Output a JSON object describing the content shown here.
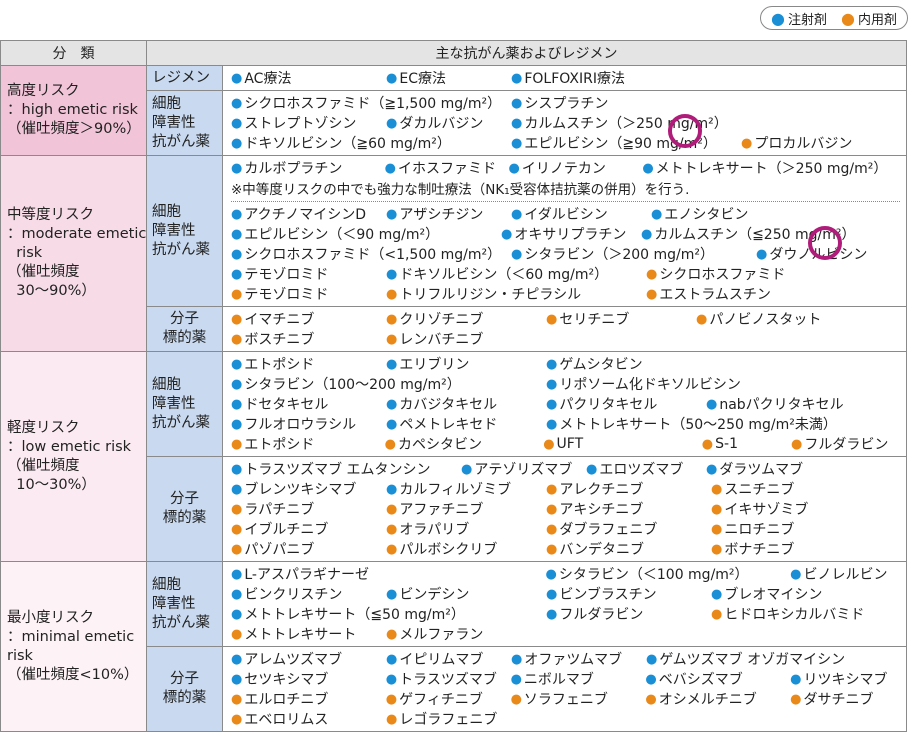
{
  "legend": {
    "injection": "注射剤",
    "oral": "内用剤"
  },
  "colors": {
    "injection": "#1a8fd6",
    "oral": "#e8891a",
    "circle": "#b01c7a"
  },
  "header": {
    "category": "分　類",
    "drugs": "主な抗がん薬およびレジメン"
  },
  "high": {
    "label": [
      "高度リスク",
      "：high emetic risk",
      "（催吐頻度＞90%）"
    ],
    "regimen_label": "レジメン",
    "regimens": [
      [
        {
          "t": "AC療法",
          "k": "b",
          "w": 155
        },
        {
          "t": "EC療法",
          "k": "b",
          "w": 125
        },
        {
          "t": "FOLFOXIRI療法",
          "k": "b",
          "w": 200
        }
      ]
    ],
    "cyto_label": [
      "細胞",
      "障害性",
      "抗がん薬"
    ],
    "cyto": [
      [
        {
          "t": "シクロホスファミド（≧1,500 mg/m²）",
          "k": "b",
          "w": 280
        },
        {
          "t": "シスプラチン",
          "k": "b",
          "w": 200
        }
      ],
      [
        {
          "t": "ストレプトゾシン",
          "k": "b",
          "w": 155
        },
        {
          "t": "ダカルバジン",
          "k": "b",
          "w": 125
        },
        {
          "t": "カルムスチン（＞250 mg/m²）",
          "k": "b",
          "w": 230
        }
      ],
      [
        {
          "t": "ドキソルビシン（≧60 mg/m²）",
          "k": "b",
          "w": 280
        },
        {
          "t": "エピルビシン（≧90 mg/m²）",
          "k": "b",
          "w": 230
        },
        {
          "t": "プロカルバジン",
          "k": "o",
          "w": 150
        }
      ]
    ]
  },
  "moderate": {
    "label": [
      "中等度リスク",
      "：moderate emetic",
      "  risk",
      "（催吐頻度",
      "  30〜90%）"
    ],
    "cyto_label": [
      "細胞",
      "障害性",
      "抗がん薬"
    ],
    "cyto_top": [
      [
        {
          "t": "カルボプラチン",
          "k": "b",
          "w": 155
        },
        {
          "t": "イホスファミド",
          "k": "b",
          "w": 125
        },
        {
          "t": "イリノテカン",
          "k": "b",
          "w": 135
        },
        {
          "t": "メトトレキサート（＞250 mg/m²）",
          "k": "b",
          "w": 260
        }
      ]
    ],
    "note": "※中等度リスクの中でも強力な制吐療法（NK₁受容体拮抗薬の併用）を行う.",
    "cyto": [
      [
        {
          "t": "アクチノマイシンD",
          "k": "b",
          "w": 155
        },
        {
          "t": "アザシチジン",
          "k": "b",
          "w": 125
        },
        {
          "t": "イダルビシン",
          "k": "b",
          "w": 140
        },
        {
          "t": "エノシタビン",
          "k": "b",
          "w": 140
        }
      ],
      [
        {
          "t": "エピルビシン（＜90 mg/m²）",
          "k": "b",
          "w": 270
        },
        {
          "t": "オキサリプラチン",
          "k": "b",
          "w": 140
        },
        {
          "t": "カルムスチン（≦250 mg/m²）",
          "k": "b",
          "w": 220
        }
      ],
      [
        {
          "t": "シクロホスファミド（<1,500 mg/m²）",
          "k": "b",
          "w": 280
        },
        {
          "t": "シタラビン（＞200 mg/m²）",
          "k": "b",
          "w": 245
        },
        {
          "t": "ダウノルビシン",
          "k": "b",
          "w": 130
        }
      ],
      [
        {
          "t": "テモゾロミド",
          "k": "b",
          "w": 155
        },
        {
          "t": "ドキソルビシン（＜60 mg/m²）",
          "k": "b",
          "w": 260
        },
        {
          "t": "シクロホスファミド",
          "k": "o",
          "w": 160
        }
      ],
      [
        {
          "t": "テモゾロミド",
          "k": "o",
          "w": 155
        },
        {
          "t": "トリフルリジン・チピラシル",
          "k": "o",
          "w": 260
        },
        {
          "t": "エストラムスチン",
          "k": "o",
          "w": 160
        }
      ]
    ],
    "mol_label": [
      "分子",
      "標的薬"
    ],
    "mol": [
      [
        {
          "t": "イマチニブ",
          "k": "o",
          "w": 155
        },
        {
          "t": "クリゾチニブ",
          "k": "o",
          "w": 160
        },
        {
          "t": "セリチニブ",
          "k": "o",
          "w": 150
        },
        {
          "t": "パノビノスタット",
          "k": "o",
          "w": 140
        }
      ],
      [
        {
          "t": "ボスチニブ",
          "k": "o",
          "w": 155
        },
        {
          "t": "レンバチニブ",
          "k": "o",
          "w": 160
        }
      ]
    ]
  },
  "low": {
    "label": [
      "軽度リスク",
      "：low emetic risk",
      "（催吐頻度",
      "  10〜30%）"
    ],
    "cyto_label": [
      "細胞",
      "障害性",
      "抗がん薬"
    ],
    "cyto": [
      [
        {
          "t": "エトポシド",
          "k": "b",
          "w": 155
        },
        {
          "t": "エリブリン",
          "k": "b",
          "w": 160
        },
        {
          "t": "ゲムシタビン",
          "k": "b",
          "w": 200
        }
      ],
      [
        {
          "t": "シタラビン（100〜200 mg/m²）",
          "k": "b",
          "w": 315
        },
        {
          "t": "リポソーム化ドキソルビシン",
          "k": "b",
          "w": 220
        }
      ],
      [
        {
          "t": "ドセタキセル",
          "k": "b",
          "w": 155
        },
        {
          "t": "カバジタキセル",
          "k": "b",
          "w": 160
        },
        {
          "t": "パクリタキセル",
          "k": "b",
          "w": 160
        },
        {
          "t": "nabパクリタキセル",
          "k": "b",
          "w": 160
        }
      ],
      [
        {
          "t": "フルオロウラシル",
          "k": "b",
          "w": 155
        },
        {
          "t": "ペメトレキセド",
          "k": "b",
          "w": 160
        },
        {
          "t": "メトトレキサート（50〜250 mg/m²未満）",
          "k": "b",
          "w": 300
        }
      ],
      [
        {
          "t": "エトポシド",
          "k": "o",
          "w": 155
        },
        {
          "t": "カペシタビン",
          "k": "o",
          "w": 160
        },
        {
          "t": "UFT",
          "k": "o",
          "w": 160
        },
        {
          "t": "S-1",
          "k": "o",
          "w": 90
        },
        {
          "t": "フルダラビン",
          "k": "o",
          "w": 110
        }
      ]
    ],
    "mol_label": [
      "分子",
      "標的薬"
    ],
    "mol": [
      [
        {
          "t": "トラスツズマブ エムタンシン",
          "k": "b",
          "w": 230
        },
        {
          "t": "アテゾリズマブ",
          "k": "b",
          "w": 125
        },
        {
          "t": "エロツズマブ",
          "k": "b",
          "w": 120
        },
        {
          "t": "ダラツムマブ",
          "k": "b",
          "w": 130
        }
      ],
      [
        {
          "t": "ブレンツキシマブ",
          "k": "b",
          "w": 155
        },
        {
          "t": "カルフィルゾミブ",
          "k": "b",
          "w": 160
        },
        {
          "t": "アレクチニブ",
          "k": "o",
          "w": 165
        },
        {
          "t": "スニチニブ",
          "k": "o",
          "w": 130
        }
      ],
      [
        {
          "t": "ラパチニブ",
          "k": "o",
          "w": 155
        },
        {
          "t": "アファチニブ",
          "k": "o",
          "w": 160
        },
        {
          "t": "アキシチニブ",
          "k": "o",
          "w": 165
        },
        {
          "t": "イキサゾミブ",
          "k": "o",
          "w": 130
        }
      ],
      [
        {
          "t": "イブルチニブ",
          "k": "o",
          "w": 155
        },
        {
          "t": "オラパリブ",
          "k": "o",
          "w": 160
        },
        {
          "t": "ダブラフェニブ",
          "k": "o",
          "w": 165
        },
        {
          "t": "ニロチニブ",
          "k": "o",
          "w": 130
        }
      ],
      [
        {
          "t": "パゾパニブ",
          "k": "o",
          "w": 155
        },
        {
          "t": "パルボシクリブ",
          "k": "o",
          "w": 160
        },
        {
          "t": "バンデタニブ",
          "k": "o",
          "w": 165
        },
        {
          "t": "ボナチニブ",
          "k": "o",
          "w": 130
        }
      ]
    ]
  },
  "minimal": {
    "label": [
      "最小度リスク",
      "：minimal emetic",
      "risk",
      "（催吐頻度<10%）"
    ],
    "cyto_label": [
      "細胞",
      "障害性",
      "抗がん薬"
    ],
    "cyto": [
      [
        {
          "t": "L-アスパラギナーゼ",
          "k": "b",
          "w": 315
        },
        {
          "t": "シタラビン（＜100 mg/m²）",
          "k": "b",
          "w": 245
        },
        {
          "t": "ビノレルビン",
          "k": "b",
          "w": 110
        }
      ],
      [
        {
          "t": "ビンクリスチン",
          "k": "b",
          "w": 155
        },
        {
          "t": "ビンデシン",
          "k": "b",
          "w": 160
        },
        {
          "t": "ビンブラスチン",
          "k": "b",
          "w": 165
        },
        {
          "t": "ブレオマイシン",
          "k": "b",
          "w": 140
        }
      ],
      [
        {
          "t": "メトトレキサート（≦50 mg/m²）",
          "k": "b",
          "w": 315
        },
        {
          "t": "フルダラビン",
          "k": "b",
          "w": 165
        },
        {
          "t": "ヒドロキシカルバミド",
          "k": "o",
          "w": 170
        }
      ],
      [
        {
          "t": "メトトレキサート",
          "k": "o",
          "w": 155
        },
        {
          "t": "メルファラン",
          "k": "o",
          "w": 160
        }
      ]
    ],
    "mol_label": [
      "分子",
      "標的薬"
    ],
    "mol": [
      [
        {
          "t": "アレムツズマブ",
          "k": "b",
          "w": 155
        },
        {
          "t": "イピリムマブ",
          "k": "b",
          "w": 125
        },
        {
          "t": "オファツムマブ",
          "k": "b",
          "w": 135
        },
        {
          "t": "ゲムツズマブ オゾガマイシン",
          "k": "b",
          "w": 240
        }
      ],
      [
        {
          "t": "セツキシマブ",
          "k": "b",
          "w": 155
        },
        {
          "t": "トラスツズマブ",
          "k": "b",
          "w": 125
        },
        {
          "t": "ニボルマブ",
          "k": "b",
          "w": 135
        },
        {
          "t": "ベバシズマブ",
          "k": "b",
          "w": 145
        },
        {
          "t": "リツキシマブ",
          "k": "b",
          "w": 110
        }
      ],
      [
        {
          "t": "エルロチニブ",
          "k": "o",
          "w": 155
        },
        {
          "t": "ゲフィチニブ",
          "k": "o",
          "w": 125
        },
        {
          "t": "ソラフェニブ",
          "k": "o",
          "w": 135
        },
        {
          "t": "オシメルチニブ",
          "k": "o",
          "w": 145
        },
        {
          "t": "ダサチニブ",
          "k": "o",
          "w": 110
        }
      ],
      [
        {
          "t": "エベロリムス",
          "k": "o",
          "w": 155
        },
        {
          "t": "レゴラフェニブ",
          "k": "o",
          "w": 125
        }
      ]
    ]
  }
}
